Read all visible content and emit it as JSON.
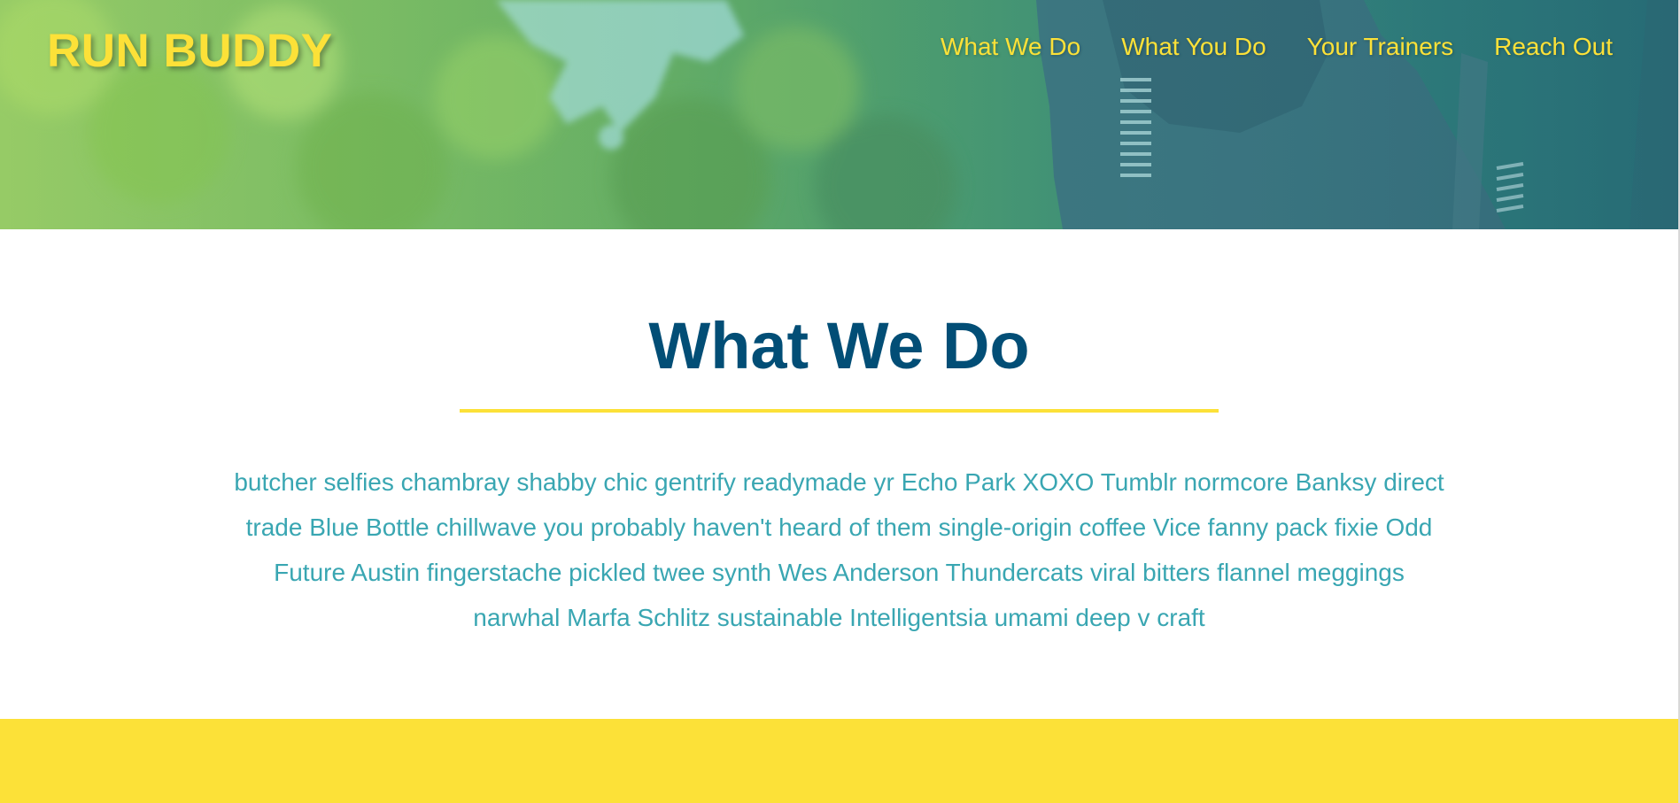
{
  "site": {
    "logo": "RUN BUDDY"
  },
  "nav": {
    "items": [
      {
        "label": "What We Do"
      },
      {
        "label": "What You Do"
      },
      {
        "label": "Your Trainers"
      },
      {
        "label": "Reach Out"
      }
    ]
  },
  "intro": {
    "title": "What We Do",
    "text": "butcher selfies chambray shabby chic gentrify readymade yr Echo Park XOXO Tumblr normcore Banksy direct trade Blue Bottle chillwave you probably haven't heard of them single-origin coffee Vice fanny pack fixie Odd Future Austin fingerstache pickled twee synth Wes Anderson Thundercats viral bitters flannel meggings narwhal Marfa Schlitz sustainable Intelligentsia umami deep v craft"
  },
  "colors": {
    "brand_yellow": "#fce138",
    "title_blue": "#024e76",
    "text_teal": "#39a6b2",
    "white": "#ffffff"
  }
}
